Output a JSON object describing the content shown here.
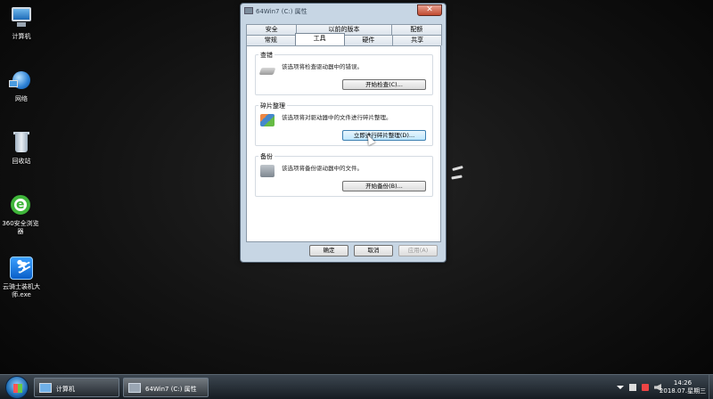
{
  "desktop": {
    "icons": [
      {
        "label": "计算机",
        "icon": "computer-icon"
      },
      {
        "label": "网络",
        "icon": "network-icon"
      },
      {
        "label": "回收站",
        "icon": "recycle-bin-icon"
      },
      {
        "label": "360安全浏览器",
        "icon": "360-browser-icon"
      },
      {
        "label": "云骑士装机大师.exe",
        "icon": "yunqishi-icon"
      }
    ]
  },
  "dialog": {
    "title": "64Win7 (C:) 属性",
    "close_glyph": "✕",
    "tabs_top": [
      "安全",
      "以前的版本",
      "配额"
    ],
    "tabs_bottom": [
      "常规",
      "工具",
      "硬件",
      "共享"
    ],
    "active_tab": "工具",
    "groups": [
      {
        "title": "查错",
        "desc": "该选项将检查驱动器中的错误。",
        "button": "开始检查(C)..."
      },
      {
        "title": "碎片整理",
        "desc": "该选项将对驱动器中的文件进行碎片整理。",
        "button": "立即进行碎片整理(D)..."
      },
      {
        "title": "备份",
        "desc": "该选项将备份驱动器中的文件。",
        "button": "开始备份(B)..."
      }
    ],
    "buttons": {
      "ok": "确定",
      "cancel": "取消",
      "apply": "应用(A)"
    }
  },
  "taskbar": {
    "items": [
      {
        "label": "计算机"
      },
      {
        "label": "64Win7  (C:) 属性"
      }
    ],
    "clock_time": "14:26",
    "clock_date": "2018.07.星期三"
  }
}
